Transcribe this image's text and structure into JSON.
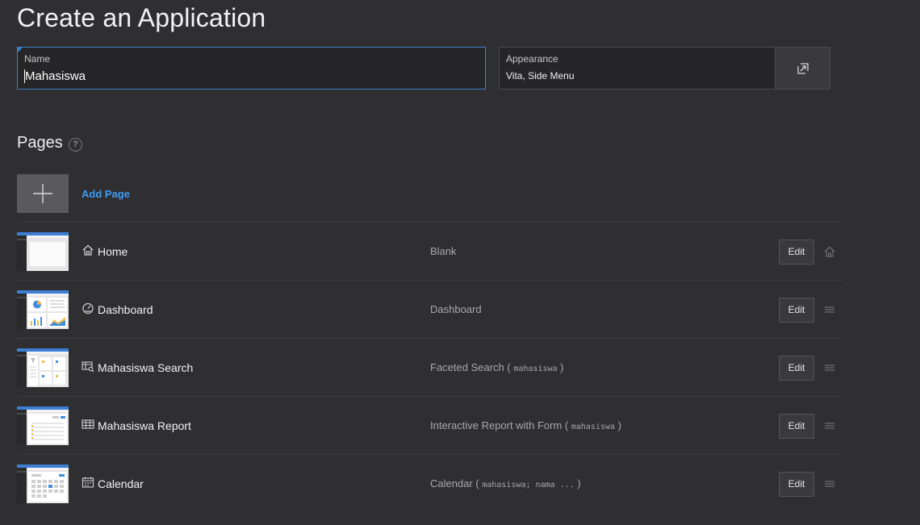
{
  "header": {
    "title": "Create an Application"
  },
  "form": {
    "name_label": "Name",
    "name_value": "Mahasiswa",
    "appearance_label": "Appearance",
    "appearance_value": "Vita, Side Menu"
  },
  "pages_section": {
    "title": "Pages",
    "help_glyph": "?",
    "add_page_label": "Add Page",
    "edit_label": "Edit",
    "items": [
      {
        "name": "Home",
        "type": "Blank",
        "type_detail": "",
        "icon": "home-icon",
        "action_icon": "home-icon"
      },
      {
        "name": "Dashboard",
        "type": "Dashboard",
        "type_detail": "",
        "icon": "dashboard-icon",
        "action_icon": "drag-handle-icon"
      },
      {
        "name": "Mahasiswa Search",
        "type": "Faceted Search",
        "type_detail": "mahasiswa",
        "icon": "faceted-search-icon",
        "action_icon": "drag-handle-icon"
      },
      {
        "name": "Mahasiswa Report",
        "type": "Interactive Report with Form",
        "type_detail": "mahasiswa",
        "icon": "report-icon",
        "action_icon": "drag-handle-icon"
      },
      {
        "name": "Calendar",
        "type": "Calendar",
        "type_detail": "mahasiswa; nama ...",
        "icon": "calendar-icon",
        "action_icon": "drag-handle-icon"
      }
    ]
  },
  "colors": {
    "background": "#2f2f31",
    "accent": "#3f9bf0",
    "focus_border": "#3d7fc4"
  }
}
